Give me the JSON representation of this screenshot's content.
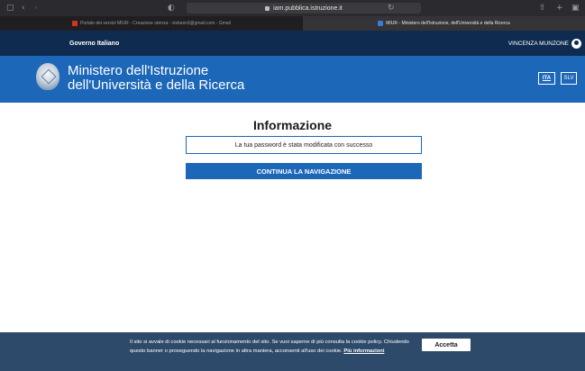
{
  "browser": {
    "url": "iam.pubblica.istruzione.it",
    "tabs": [
      {
        "label": "Portale dei servizi MIUR - Creazione utenza - visbesn3@gmail.com - Gmail",
        "active": false
      },
      {
        "label": "MIUR - Ministero dell'Istruzione, dell'Università e della Ricerca",
        "active": true
      }
    ]
  },
  "gov_bar": {
    "title": "Governo Italiano",
    "user_name": "VINCENZA MUNZONE"
  },
  "header": {
    "title_line1": "Ministero dell'Istruzione",
    "title_line2": "dell'Università e della Ricerca",
    "lang_ita": "ITA",
    "lang_slv": "SLV"
  },
  "main": {
    "title": "Informazione",
    "message": "La tua password è stata modificata con successo",
    "continue_label": "CONTINUA LA NAVIGAZIONE"
  },
  "cookie_banner": {
    "text": "Il sito si avvale di cookie necessari al funzionamento del sito. Se vuoi saperne di più consulta la cookie policy. Chiudendo questo banner o proseguendo la navigazione in altra maniera, acconsenti all'uso dei cookie.",
    "link_label": "Più informazioni",
    "accept_label": "Accetta"
  },
  "colors": {
    "gov_bar": "#0f2b4f",
    "header_blue": "#1c67b8",
    "cookie_bg": "#2e4a6a",
    "gmail_favicon": "#d93025",
    "miur_favicon": "#3a7bd5"
  }
}
